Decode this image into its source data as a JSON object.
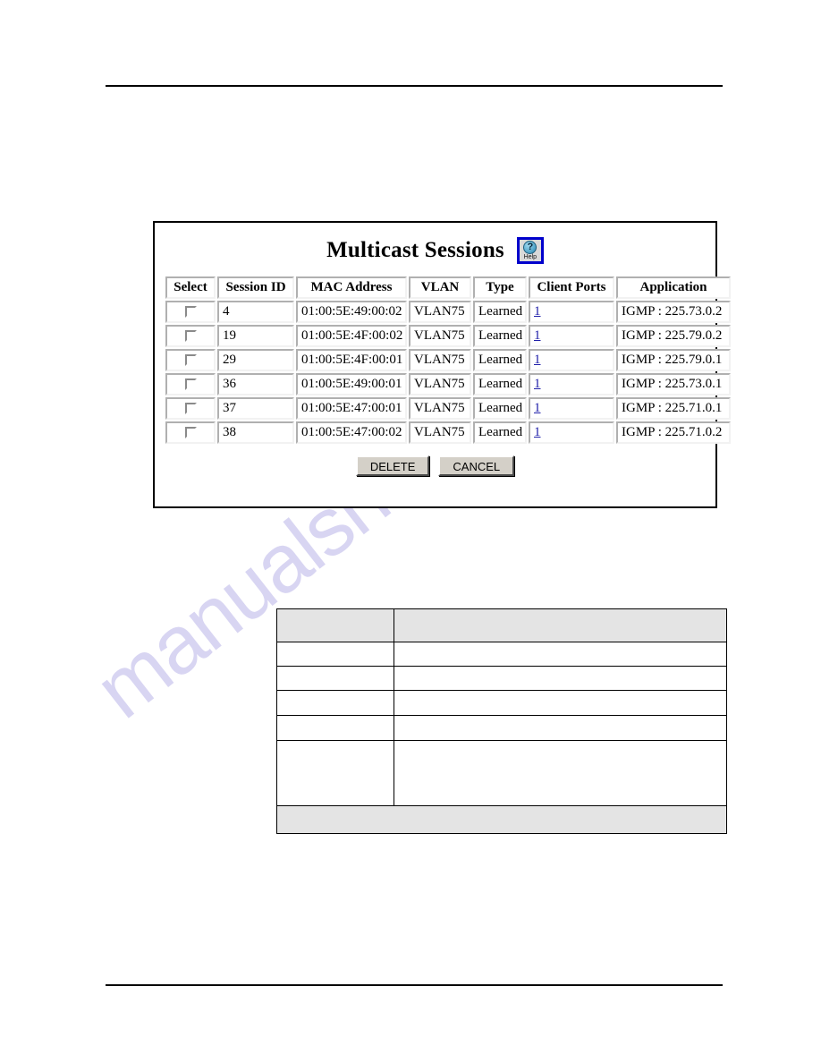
{
  "page": {
    "watermark": "manualshive.com",
    "rules": {
      "top": "",
      "bottom": ""
    }
  },
  "panel": {
    "title": "Multicast Sessions",
    "help_button": {
      "name": "help-button",
      "label": "Help",
      "glyph": "?",
      "border_color": "#0000cc"
    },
    "table": {
      "columns": [
        "Select",
        "Session ID",
        "MAC Address",
        "VLAN",
        "Type",
        "Client Ports",
        "Application"
      ],
      "rows": [
        {
          "selected": false,
          "session_id": "4",
          "mac_address": "01:00:5E:49:00:02",
          "vlan": "VLAN75",
          "type": "Learned",
          "client_ports": "1",
          "application": "IGMP : 225.73.0.2"
        },
        {
          "selected": false,
          "session_id": "19",
          "mac_address": "01:00:5E:4F:00:02",
          "vlan": "VLAN75",
          "type": "Learned",
          "client_ports": "1",
          "application": "IGMP : 225.79.0.2"
        },
        {
          "selected": false,
          "session_id": "29",
          "mac_address": "01:00:5E:4F:00:01",
          "vlan": "VLAN75",
          "type": "Learned",
          "client_ports": "1",
          "application": "IGMP : 225.79.0.1"
        },
        {
          "selected": false,
          "session_id": "36",
          "mac_address": "01:00:5E:49:00:01",
          "vlan": "VLAN75",
          "type": "Learned",
          "client_ports": "1",
          "application": "IGMP : 225.73.0.1"
        },
        {
          "selected": false,
          "session_id": "37",
          "mac_address": "01:00:5E:47:00:01",
          "vlan": "VLAN75",
          "type": "Learned",
          "client_ports": "1",
          "application": "IGMP : 225.71.0.1"
        },
        {
          "selected": false,
          "session_id": "38",
          "mac_address": "01:00:5E:47:00:02",
          "vlan": "VLAN75",
          "type": "Learned",
          "client_ports": "1",
          "application": "IGMP : 225.71.0.2"
        }
      ]
    },
    "buttons": {
      "delete": "DELETE",
      "cancel": "CANCEL"
    }
  },
  "reference_table": {
    "header": [
      "",
      ""
    ],
    "rows": [
      [
        "",
        ""
      ],
      [
        "",
        ""
      ],
      [
        "",
        ""
      ],
      [
        "",
        ""
      ],
      [
        "",
        ""
      ]
    ],
    "footer": ""
  },
  "colors": {
    "link": "#2020aa",
    "help_border": "#0000cc",
    "button_face": "#d4d0c8",
    "header_fill": "#e4e4e4",
    "watermark": "#b9b4e8"
  }
}
